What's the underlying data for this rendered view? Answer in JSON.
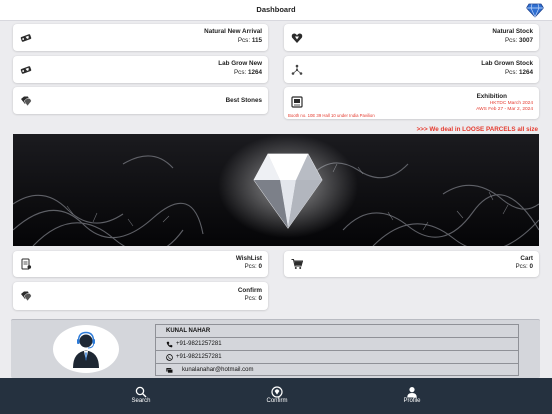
{
  "header": {
    "title": "Dashboard",
    "logo_icon": "diamond-logo-icon"
  },
  "cards": {
    "natural_new_arrival": {
      "name": "Natural New Arrival",
      "pcs_label": "Pcs:",
      "pcs_value": "115",
      "icon": "diamond-tag-icon"
    },
    "natural_stock": {
      "name": "Natural Stock",
      "pcs_label": "Pcs:",
      "pcs_value": "3007",
      "icon": "heart-diamond-icon"
    },
    "lab_grow_new": {
      "name": "Lab Grow New",
      "pcs_label": "Pcs:",
      "pcs_value": "1264",
      "icon": "diamond-tag-icon"
    },
    "lab_grown_stock": {
      "name": "Lab Grown Stock",
      "pcs_label": "Pcs:",
      "pcs_value": "1264",
      "icon": "molecule-icon"
    },
    "best_stones": {
      "name": "Best Stones",
      "icon": "gem-stack-icon"
    },
    "exhibition": {
      "name": "Exhibition",
      "line1": "HKTDC March 2024",
      "line2": "AWS Feb 27 - Mar 2, 2024",
      "booth": "Booth no. 10E 39 Hall 10 under India Pavilion",
      "icon": "exhibition-icon"
    },
    "wishlist": {
      "name": "WishList",
      "pcs_label": "Pcs:",
      "pcs_value": "0",
      "icon": "wishlist-icon"
    },
    "cart": {
      "name": "Cart",
      "pcs_label": "Pcs:",
      "pcs_value": "0",
      "icon": "cart-icon"
    },
    "confirm": {
      "name": "Confirm",
      "pcs_label": "Pcs:",
      "pcs_value": "0",
      "icon": "gem-stack-icon"
    }
  },
  "tagline": ">>> We deal in LOOSE PARCELS all size",
  "banner": {
    "subject": "diamond-banner-image"
  },
  "contact": {
    "name": "KUNAL NAHAR",
    "phone": "+91-9821257281",
    "whatsapp": "+91-9821257281",
    "email": "kunalanahar@hotmail.com",
    "avatar_icon": "support-agent-icon"
  },
  "tabs": [
    {
      "label": "Search",
      "icon": "search-icon"
    },
    {
      "label": "Confirm",
      "icon": "confirm-icon"
    },
    {
      "label": "Profile",
      "icon": "profile-icon"
    }
  ],
  "colors": {
    "tabbar": "#25313f",
    "accent_red": "#e53a2e",
    "background": "#ececef"
  }
}
